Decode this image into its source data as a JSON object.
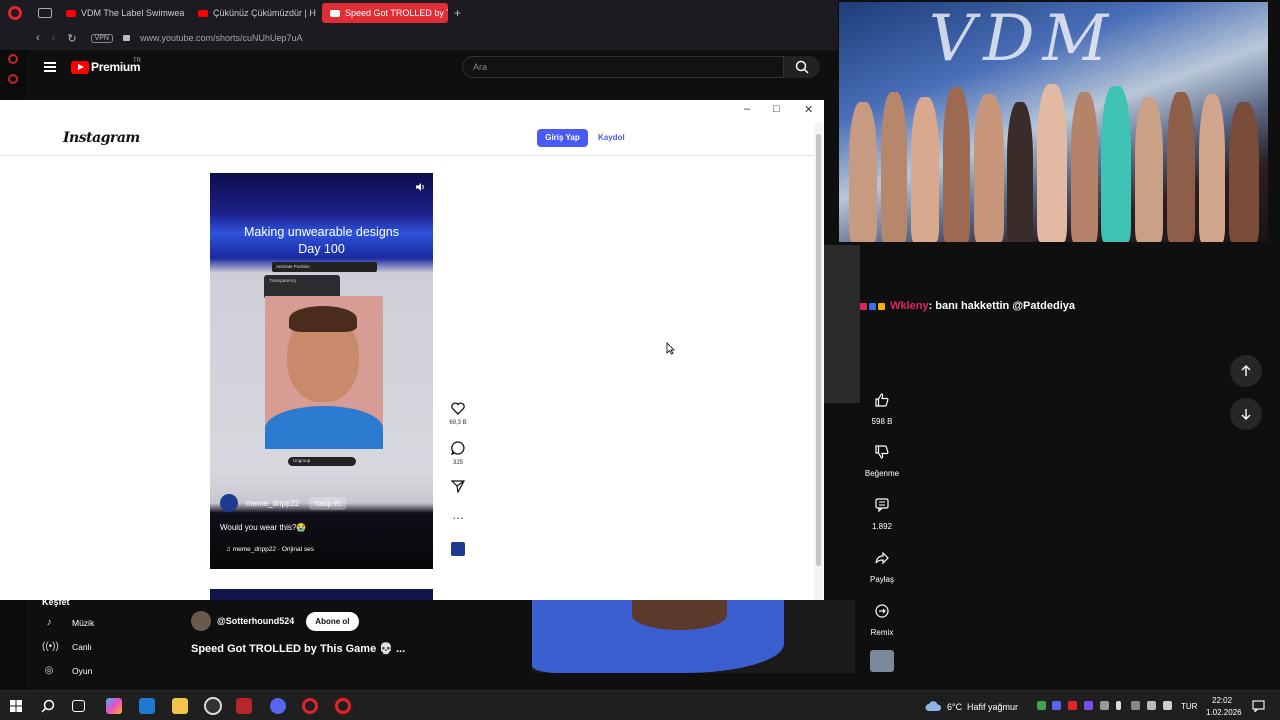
{
  "browser": {
    "tabs": [
      {
        "label": "VDM The Label Swimwea"
      },
      {
        "label": "Çükünüz Çükümüzdür | H"
      },
      {
        "label": "Speed Got TROLLED by Th"
      }
    ],
    "vpn_label": "VPN",
    "url": "www.youtube.com/shorts/cuNUhUep7uA"
  },
  "youtube": {
    "logo_text": "Premium",
    "region": "TR",
    "search_placeholder": "Ara",
    "sidebar": {
      "section": "Keşfet",
      "items": [
        {
          "label": "Müzik",
          "icon": "music-note-icon"
        },
        {
          "label": "Canlı",
          "icon": "live-icon"
        },
        {
          "label": "Oyun",
          "icon": "gamepad-icon"
        }
      ]
    },
    "channel": {
      "handle": "@Sotterhound524",
      "subscribe_label": "Abone ol"
    },
    "video_title": "Speed Got TROLLED by This Game 💀 ...",
    "actions": {
      "likes": "598 B",
      "dislike_label": "Beğenme",
      "comments": "1.892",
      "share_label": "Paylaş",
      "remix_label": "Remix"
    }
  },
  "instagram": {
    "logo": "Instagram",
    "login_label": "Giriş Yap",
    "signup_label": "Kaydol",
    "reel": {
      "title_line1": "Making unwearable designs",
      "title_line2": "Day 100",
      "toolbar_text": "Animate   Position",
      "transparency_label": "Transparency",
      "bar_text": "Ungroup",
      "username": "meme_dripp22",
      "follow_label": "Takip Et",
      "caption": "Would you wear this?😭",
      "audio": "meme_dripp22 · Orijinal ses"
    },
    "likes": "69,3 B",
    "comments": "325"
  },
  "stream": {
    "overlay_text": "VDM",
    "chat": {
      "user": "Wkleny",
      "message": ": banı hakkettin @Patdediya"
    }
  },
  "taskbar": {
    "weather": "6°C",
    "weather_desc": "Hafif yağmur",
    "lang": "TUR",
    "time": "22:02",
    "date": "1.02.2026"
  },
  "colors": {
    "yt_red": "#ff0000",
    "opera_tab": "#e02d36",
    "ig_blue": "#4a5bf5",
    "chat_user": "#e0245e"
  }
}
